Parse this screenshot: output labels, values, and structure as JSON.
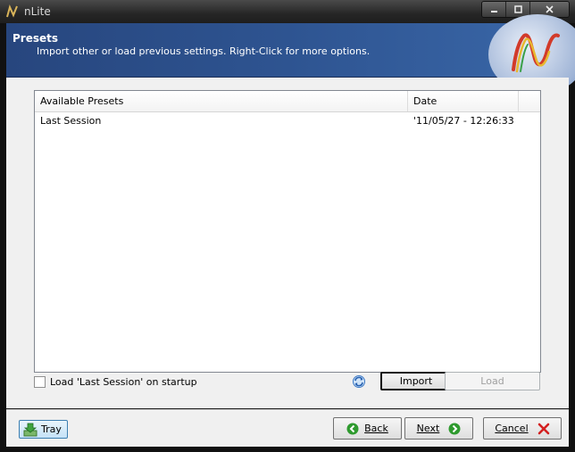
{
  "window": {
    "title": "nLite"
  },
  "header": {
    "title": "Presets",
    "subtitle": "Import other or load previous settings. Right-Click for more options."
  },
  "presets": {
    "columns": [
      "Available Presets",
      "Date"
    ],
    "rows": [
      {
        "name": "Last Session",
        "date": "'11/05/27 - 12:26:33"
      }
    ]
  },
  "options": {
    "load_on_startup_label": "Load 'Last Session' on startup",
    "load_on_startup_checked": false
  },
  "actions": {
    "import_label": "Import",
    "load_label": "Load"
  },
  "footer": {
    "tray_label": "Tray",
    "back_label": "Back",
    "next_label": "Next",
    "cancel_label": "Cancel"
  },
  "colors": {
    "header_bg": "#2e5491",
    "accent_green": "#2e9a2e",
    "cancel_red": "#d32020"
  }
}
